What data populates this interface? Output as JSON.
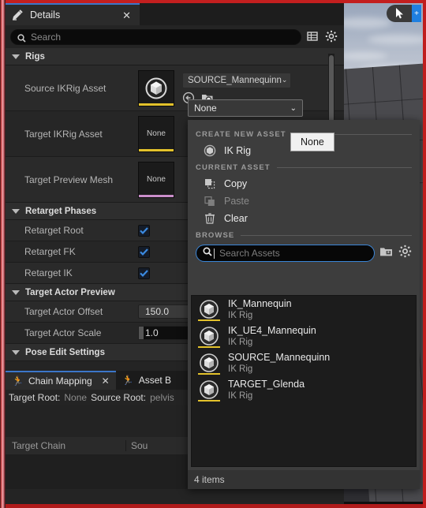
{
  "window": {
    "accent_red": "#c31f1f",
    "panel_bg": "#242424",
    "highlight_blue": "#3b76c9",
    "asset_yellow": "#e3c22b",
    "mesh_pink": "#c98ec9"
  },
  "details_tab": {
    "icon": "details-pencil-icon",
    "label": "Details",
    "close": "✕"
  },
  "search": {
    "icon": "search-icon",
    "placeholder": "Search",
    "grid_icon": "column-settings-icon",
    "gear_icon": "view-options-gear-icon"
  },
  "sections": [
    {
      "name": "rigs",
      "label": "Rigs"
    },
    {
      "name": "retarget_phases",
      "label": "Retarget Phases"
    },
    {
      "name": "target_actor_preview",
      "label": "Target Actor Preview"
    },
    {
      "name": "pose_edit_settings",
      "label": "Pose Edit Settings"
    }
  ],
  "rigs": {
    "source_ikrig": {
      "label": "Source IKRig Asset",
      "thumb_state": "cube",
      "thumb_bar_color": "#e3c22b",
      "combo_value": "SOURCE_Mannequinn",
      "chevron": "⌄",
      "browse_icon": "browse-to-asset-icon",
      "use_selected_icon": "use-selected-asset-icon"
    },
    "target_ikrig": {
      "label": "Target IKRig Asset",
      "thumb_state": "None",
      "thumb_bar_color": "#e3c22b",
      "combo_value": "None",
      "chevron": "⌄"
    },
    "target_preview_mesh": {
      "label": "Target Preview Mesh",
      "thumb_state": "None",
      "thumb_bar_color": "#c98ec9"
    }
  },
  "retarget_phases": [
    {
      "label": "Retarget Root",
      "checked": true
    },
    {
      "label": "Retarget FK",
      "checked": true
    },
    {
      "label": "Retarget IK",
      "checked": true
    }
  ],
  "target_actor_preview": [
    {
      "label": "Target Actor Offset",
      "value": "150.0",
      "style": "slider"
    },
    {
      "label": "Target Actor Scale",
      "value": "1.0",
      "style": "dark"
    }
  ],
  "picker": {
    "combo_value": "None",
    "chevron": "⌄",
    "tooltip": "None",
    "create_new_asset": {
      "header": "CREATE NEW ASSET",
      "items": [
        {
          "label": "IK Rig",
          "icon": "ik-rig-asset-icon",
          "disabled": false
        }
      ]
    },
    "current_asset": {
      "header": "CURRENT ASSET",
      "items": [
        {
          "label": "Copy",
          "icon": "copy-icon",
          "disabled": false
        },
        {
          "label": "Paste",
          "icon": "paste-icon",
          "disabled": true
        },
        {
          "label": "Clear",
          "icon": "trash-icon",
          "disabled": false
        }
      ]
    },
    "browse": {
      "header": "BROWSE",
      "search_placeholder": "Search Assets",
      "search_icon": "search-icon",
      "filter_icon": "asset-filter-icon",
      "settings_icon": "view-settings-gear-icon"
    },
    "assets": [
      {
        "name": "IK_Mannequin",
        "type": "IK Rig"
      },
      {
        "name": "IK_UE4_Mannequin",
        "type": "IK Rig"
      },
      {
        "name": "SOURCE_Mannequinn",
        "type": "IK Rig"
      },
      {
        "name": "TARGET_Glenda",
        "type": "IK Rig"
      }
    ],
    "status": "4 items"
  },
  "bottom_dock": {
    "tabs": [
      {
        "label": "Chain Mapping",
        "icon": "running-man-icon",
        "active": true,
        "close": "✕"
      },
      {
        "label": "Asset B",
        "icon": "running-man-icon",
        "active": false
      }
    ],
    "target_root_label": "Target Root:",
    "target_root_value": "None",
    "source_root_label": "Source Root:",
    "source_root_value": "pelvis",
    "columns": [
      {
        "label": "Target Chain"
      },
      {
        "label": "Sou"
      }
    ]
  },
  "viewport": {
    "cursor_icon": "select-cursor-icon",
    "plus_icon": "add-icon"
  }
}
